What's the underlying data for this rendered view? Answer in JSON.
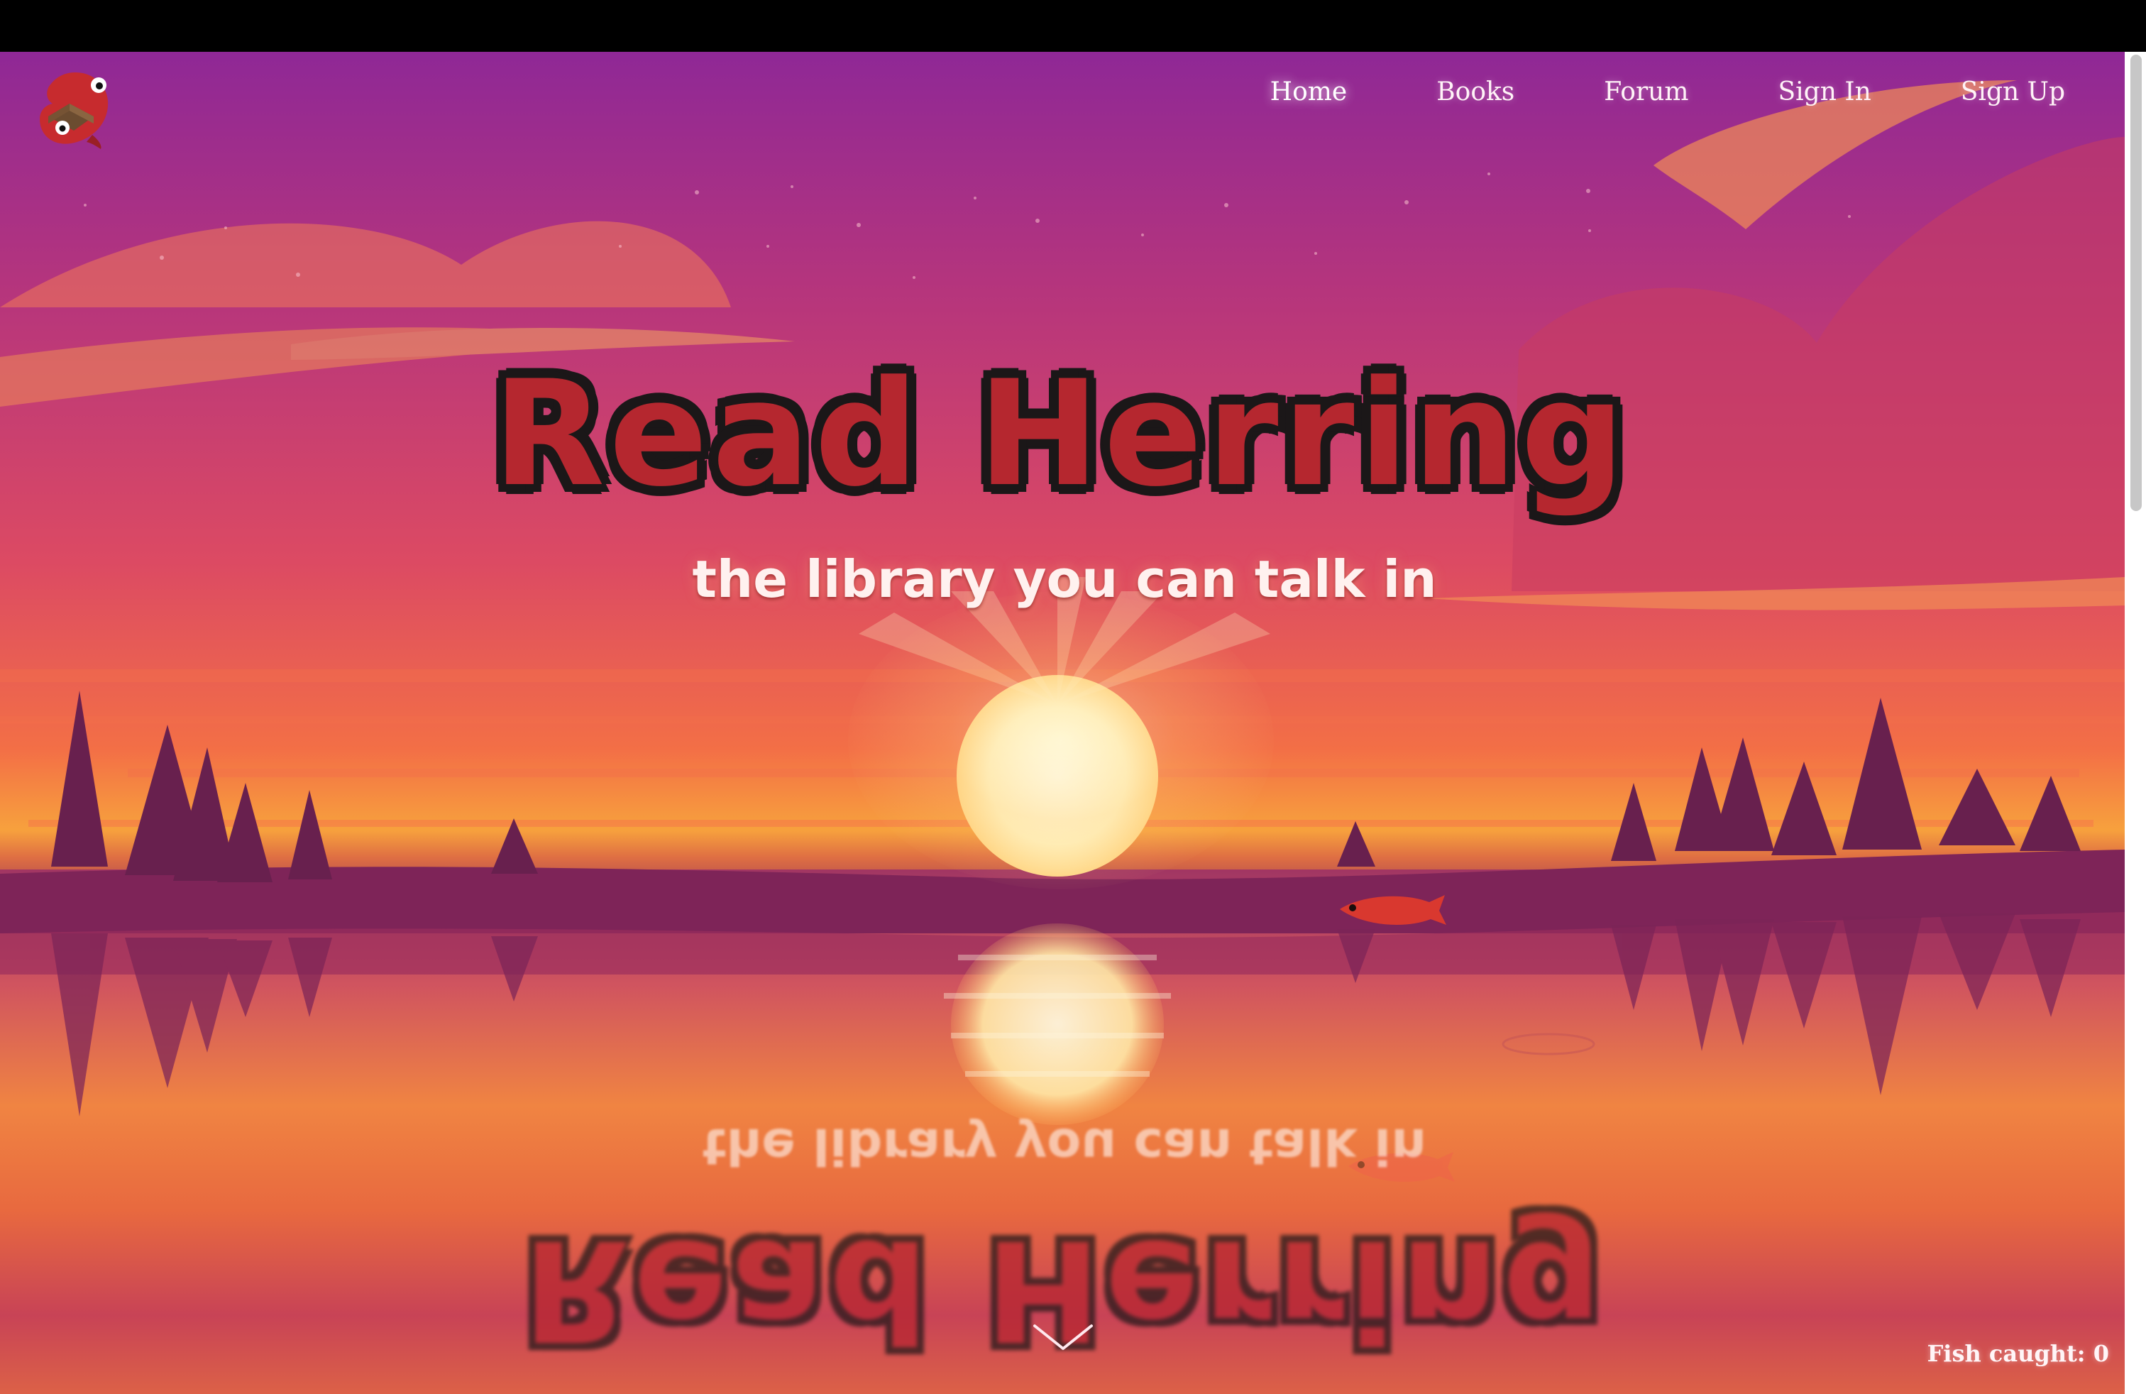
{
  "app": {
    "title": "Read Herring",
    "subtitle": "the library you can talk in"
  },
  "nav": {
    "items": [
      {
        "label": "Home",
        "active": true
      },
      {
        "label": "Books",
        "active": false
      },
      {
        "label": "Forum",
        "active": false
      },
      {
        "label": "Sign In",
        "active": false
      },
      {
        "label": "Sign Up",
        "active": false
      }
    ]
  },
  "status": {
    "fish_caught": "Fish caught: 0"
  },
  "icons": {
    "logo": "fish-book-logo-icon",
    "scroll": "chevron-down-icon"
  },
  "colors": {
    "title_fill": "#b5272f",
    "title_outline": "#1b1718",
    "subtitle": "#fff1ef",
    "nav_text": "#fff3f7",
    "sky_top": "#8e2a9b",
    "sunset": "#f48d37"
  }
}
